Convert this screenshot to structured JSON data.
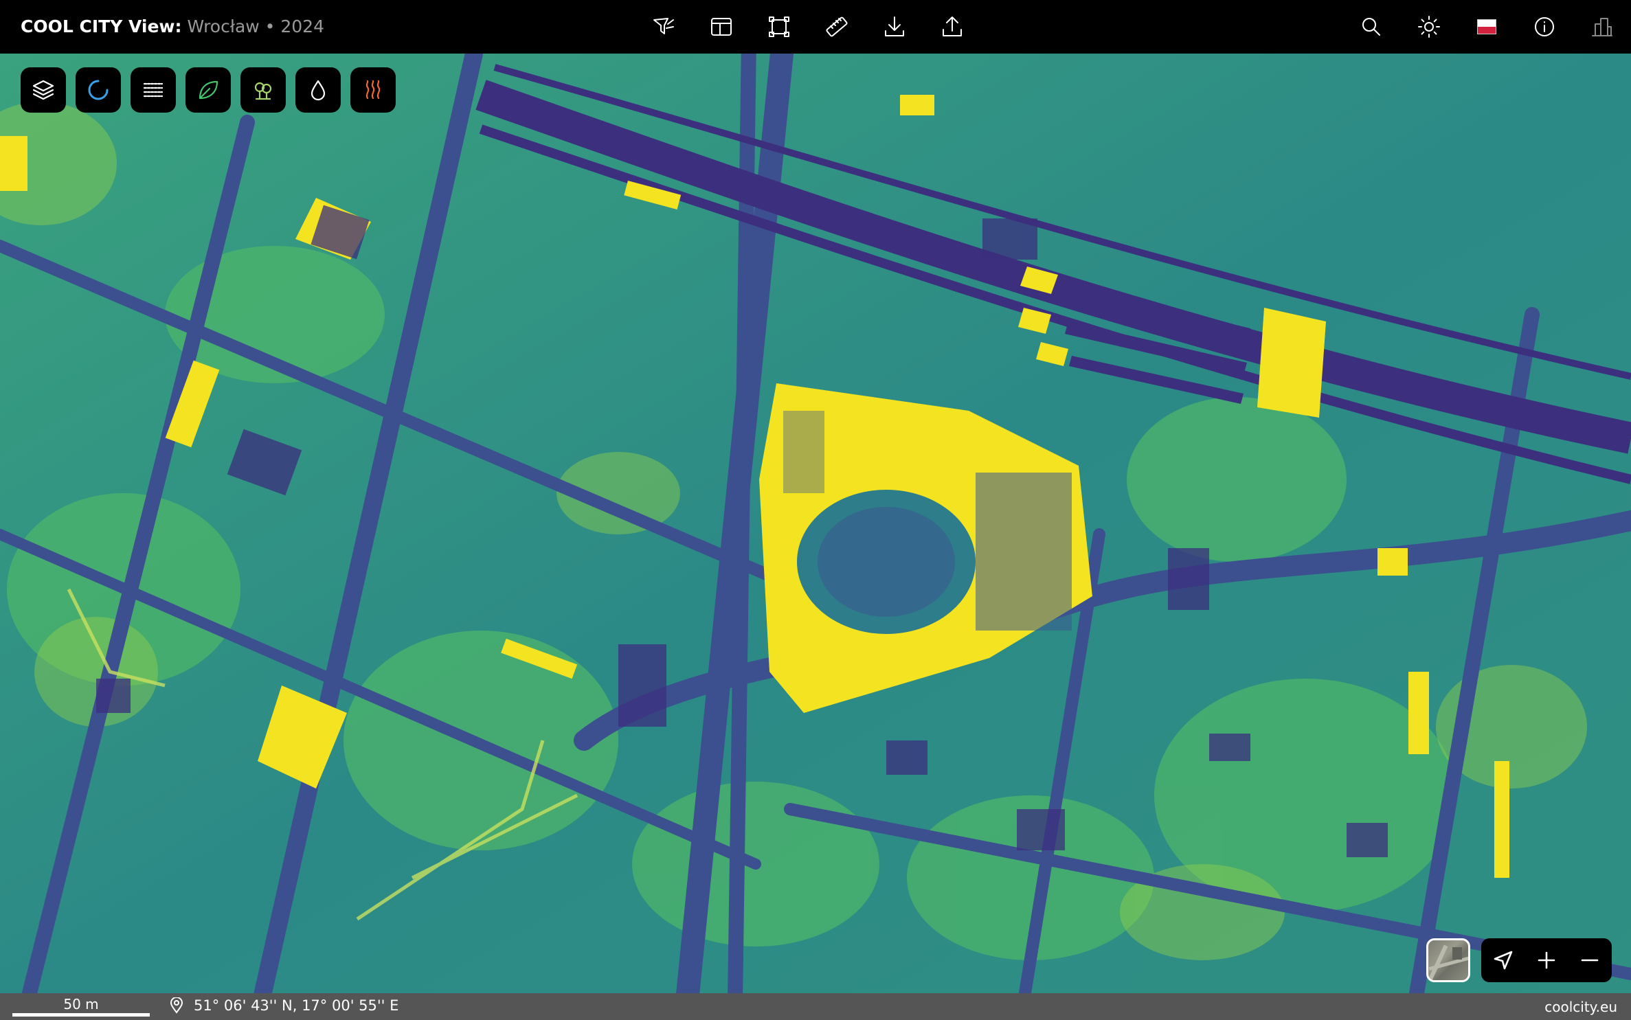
{
  "header": {
    "brand": "COOL CITY View:",
    "subtitle": "Wrocław • 2024"
  },
  "toolbar": {
    "center_icons": [
      "filter-map-icon",
      "layout-icon",
      "bounding-box-icon",
      "ruler-icon",
      "download-icon",
      "share-icon"
    ],
    "right_icons": [
      "search-icon",
      "theme-sun-icon",
      "language-flag-pl",
      "info-icon",
      "buildings-icon"
    ]
  },
  "layers": {
    "buttons": [
      {
        "icon": "layers-icon",
        "color": "#ffffff"
      },
      {
        "icon": "loading-ring-icon",
        "color": "#3aa0e8"
      },
      {
        "icon": "hatch-lines-icon",
        "color": "#ffffff"
      },
      {
        "icon": "leaf-icon",
        "color": "#45c46b"
      },
      {
        "icon": "tree-icon",
        "color": "#a7d46a"
      },
      {
        "icon": "water-drop-icon",
        "color": "#ffffff"
      },
      {
        "icon": "heat-waves-icon",
        "color": "#f26a2a"
      }
    ]
  },
  "map": {
    "palette": [
      "#3b2f7e",
      "#3b5a8f",
      "#2d7d8a",
      "#25988a",
      "#3fb86b",
      "#8ed14a",
      "#f4e321"
    ]
  },
  "status": {
    "scale_label": "50 m",
    "coordinates": "51° 06' 43'' N, 17° 00' 55'' E",
    "credit": "coolcity.eu"
  }
}
